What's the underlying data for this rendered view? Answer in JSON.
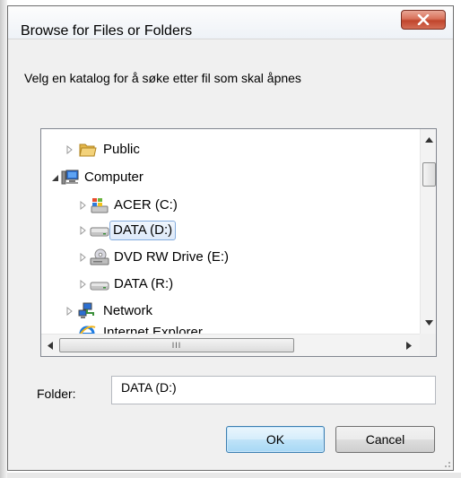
{
  "window": {
    "title": "Browse for Files or Folders",
    "close_icon": "close-x-icon"
  },
  "prompt": "Velg en katalog for å søke etter fil som skal åpnes",
  "tree": {
    "items": [
      {
        "label": "Public",
        "icon": "folder-icon",
        "expander": "collapsed"
      },
      {
        "label": "Computer",
        "icon": "computer-icon",
        "expander": "expanded"
      },
      {
        "label": "ACER (C:)",
        "icon": "windows-drive-icon",
        "expander": "collapsed"
      },
      {
        "label": "DATA (D:)",
        "icon": "hard-drive-icon",
        "expander": "collapsed",
        "selected": true
      },
      {
        "label": "DVD RW Drive (E:)",
        "icon": "dvd-drive-icon",
        "expander": "collapsed"
      },
      {
        "label": "DATA (R:)",
        "icon": "hard-drive-icon",
        "expander": "collapsed"
      },
      {
        "label": "Network",
        "icon": "network-icon",
        "expander": "collapsed"
      },
      {
        "label": "Internet Explorer",
        "icon": "internet-explorer-icon",
        "expander": "none"
      }
    ]
  },
  "scrollbars": {
    "hthumb_grip": "III"
  },
  "folder": {
    "label": "Folder:",
    "value": "DATA (D:)"
  },
  "buttons": {
    "ok": "OK",
    "cancel": "Cancel"
  },
  "colors": {
    "selection_border": "#84acdd",
    "close_button": "#c0452c",
    "ok_border": "#3c7fb1"
  }
}
